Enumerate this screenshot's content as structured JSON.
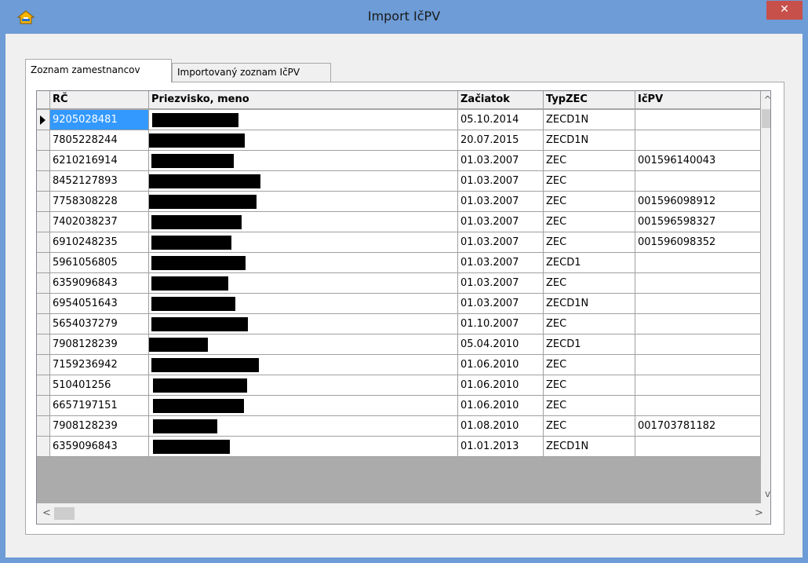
{
  "window": {
    "title": "Import IčPV",
    "app_icon": "app-house-icon",
    "close_label": "✕"
  },
  "tabs": [
    {
      "label": "Zoznam zamestnancov",
      "active": true
    },
    {
      "label": "Importovaný zoznam IčPV",
      "active": false
    }
  ],
  "grid": {
    "columns": [
      "RČ",
      "Priezvisko, meno",
      "Začiatok",
      "TypZEC",
      "IčPV"
    ],
    "rows": [
      {
        "rc": "9205028481",
        "name": "",
        "start": "05.10.2014",
        "typ": "ZECD1N",
        "icpv": ""
      },
      {
        "rc": "7805228244",
        "name": "",
        "start": "20.07.2015",
        "typ": "ZECD1N",
        "icpv": ""
      },
      {
        "rc": "6210216914",
        "name": "",
        "start": "01.03.2007",
        "typ": "ZEC",
        "icpv": "001596140043"
      },
      {
        "rc": "8452127893",
        "name": "",
        "start": "01.03.2007",
        "typ": "ZEC",
        "icpv": ""
      },
      {
        "rc": "7758308228",
        "name": "",
        "start": "01.03.2007",
        "typ": "ZEC",
        "icpv": "001596098912"
      },
      {
        "rc": "7402038237",
        "name": "",
        "start": "01.03.2007",
        "typ": "ZEC",
        "icpv": "001596598327"
      },
      {
        "rc": "6910248235",
        "name": "",
        "start": "01.03.2007",
        "typ": "ZEC",
        "icpv": "001596098352"
      },
      {
        "rc": "5961056805",
        "name": "",
        "start": "01.03.2007",
        "typ": "ZECD1",
        "icpv": ""
      },
      {
        "rc": "6359096843",
        "name": "",
        "start": "01.03.2007",
        "typ": "ZEC",
        "icpv": ""
      },
      {
        "rc": "6954051643",
        "name": "",
        "start": "01.03.2007",
        "typ": "ZECD1N",
        "icpv": ""
      },
      {
        "rc": "5654037279",
        "name": "",
        "start": "01.10.2007",
        "typ": "ZEC",
        "icpv": ""
      },
      {
        "rc": "7908128239",
        "name": "",
        "start": "05.04.2010",
        "typ": "ZECD1",
        "icpv": ""
      },
      {
        "rc": "7159236942",
        "name": "",
        "start": "01.06.2010",
        "typ": "ZEC",
        "icpv": ""
      },
      {
        "rc": "510401256",
        "name": "",
        "start": "01.06.2010",
        "typ": "ZEC",
        "icpv": ""
      },
      {
        "rc": "6657197151",
        "name": "",
        "start": "01.06.2010",
        "typ": "ZEC",
        "icpv": ""
      },
      {
        "rc": "7908128239",
        "name": "",
        "start": "01.08.2010",
        "typ": "ZEC",
        "icpv": "001703781182"
      },
      {
        "rc": "6359096843",
        "name": "",
        "start": "01.01.2013",
        "typ": "ZECD1N",
        "icpv": ""
      }
    ],
    "current_row_indicator": "row-pointer-icon"
  },
  "scrollbars": {
    "up": "^",
    "down": "v",
    "left": "<",
    "right": ">"
  },
  "colors": {
    "titlebar": "#6d9cd6",
    "close": "#c7504a",
    "selection": "#3399ff"
  }
}
